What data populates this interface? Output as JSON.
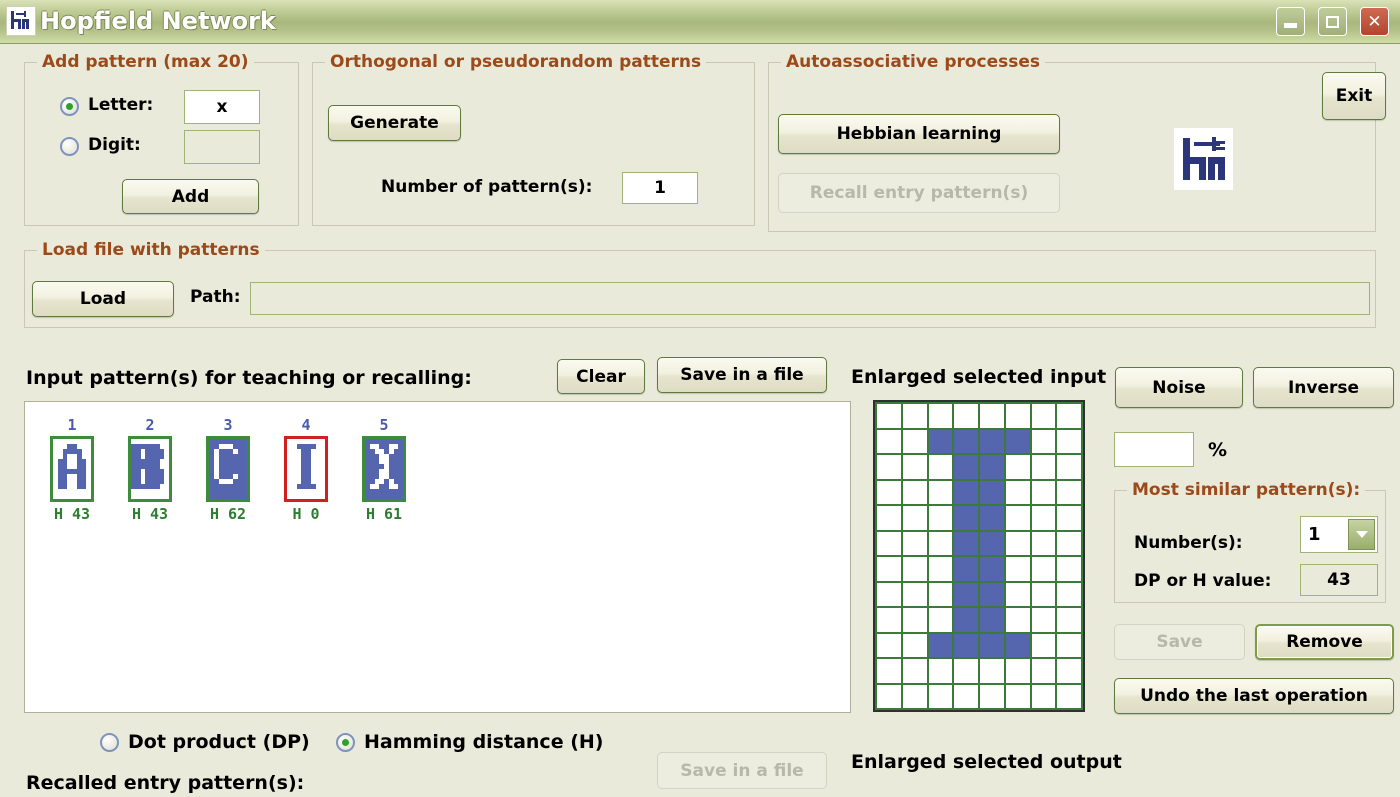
{
  "window": {
    "title": "Hopfield Network",
    "icon": "hn-logo-icon",
    "minimize_label": "_",
    "maximize_label": "□",
    "close_label": "✕"
  },
  "add_pattern": {
    "legend": "Add pattern (max 20)",
    "letter_label": "Letter:",
    "letter_value": "x",
    "letter_selected": true,
    "digit_label": "Digit:",
    "digit_value": "",
    "digit_selected": false,
    "add_label": "Add"
  },
  "orthogonal": {
    "legend": "Orthogonal or pseudorandom patterns",
    "generate_label": "Generate",
    "number_label": "Number of pattern(s):",
    "number_value": "1"
  },
  "autoassociative": {
    "legend": "Autoassociative processes",
    "hebbian_label": "Hebbian learning",
    "recall_label": "Recall entry pattern(s)",
    "recall_disabled": true,
    "logo": "hn-logo-icon"
  },
  "exit": {
    "label": "Exit"
  },
  "load_file": {
    "legend": "Load file with patterns",
    "load_label": "Load",
    "path_label": "Path:",
    "path_value": ""
  },
  "input_section": {
    "title": "Input pattern(s) for teaching or recalling:",
    "clear_label": "Clear",
    "save_label": "Save in a file",
    "enlarged_input_label": "Enlarged selected input",
    "enlarged_output_label": "Enlarged selected output",
    "recalled_label": "Recalled entry pattern(s):",
    "recalled_save_label": "Save in a file",
    "recalled_save_disabled": true
  },
  "metric": {
    "dot_label": "Dot product (DP)",
    "dot_selected": false,
    "hamming_label": "Hamming distance (H)",
    "hamming_selected": true
  },
  "right_panel": {
    "noise_label": "Noise",
    "inverse_label": "Inverse",
    "percent_value": "",
    "percent_symbol": "%",
    "similar_legend": "Most similar pattern(s):",
    "numbers_label": "Number(s):",
    "numbers_value": "1",
    "dp_or_h_label": "DP or H value:",
    "dp_or_h_value": "43",
    "save_label": "Save",
    "save_disabled": true,
    "remove_label": "Remove",
    "undo_label": "Undo the last operation"
  },
  "patterns": [
    {
      "number": "1",
      "letter": "A",
      "metric": "H 43",
      "selected": false,
      "grid": [
        "00000000",
        "00011000",
        "00111100",
        "00100100",
        "01100110",
        "01100110",
        "01111110",
        "01100110",
        "01100110",
        "01100110",
        "00000000",
        "00000000"
      ]
    },
    {
      "number": "2",
      "letter": "B",
      "metric": "H 43",
      "selected": false,
      "grid": [
        "00000000",
        "11111100",
        "11011110",
        "11011110",
        "11111100",
        "11111100",
        "11011110",
        "11011110",
        "11011110",
        "11111100",
        "00000000",
        "00000000"
      ]
    },
    {
      "number": "3",
      "letter": "C",
      "metric": "H 62",
      "selected": false,
      "grid": [
        "11111111",
        "11000111",
        "10111011",
        "10111111",
        "10111111",
        "10111111",
        "10111111",
        "10111011",
        "11000111",
        "11111111",
        "11111111",
        "11111111"
      ]
    },
    {
      "number": "4",
      "letter": "I",
      "metric": "H 0",
      "selected": true,
      "grid": [
        "00000000",
        "00111100",
        "00011000",
        "00011000",
        "00011000",
        "00011000",
        "00011000",
        "00011000",
        "00011000",
        "00111100",
        "00000000",
        "00000000"
      ]
    },
    {
      "number": "5",
      "letter": "X",
      "metric": "H 61",
      "selected": false,
      "grid": [
        "11111111",
        "10011001",
        "11001011",
        "11100111",
        "11100111",
        "11110111",
        "11100111",
        "11100111",
        "11001011",
        "10011001",
        "11111111",
        "11111111"
      ]
    }
  ],
  "enlarged_input_grid": [
    "00000000",
    "00111100",
    "00011000",
    "00011000",
    "00011000",
    "00011000",
    "00011000",
    "00011000",
    "00011000",
    "00111100",
    "00000000",
    "00000000"
  ],
  "colors": {
    "background": "#EAEADA",
    "legend_text": "#9C4A1A",
    "pixel_on": "#5566AE",
    "selected_border": "#D02020",
    "unselected_border": "#3C8C3C",
    "metric_text": "#2E7D32",
    "number_text": "#4A5BAE",
    "titlebar": "#A8B87C"
  }
}
